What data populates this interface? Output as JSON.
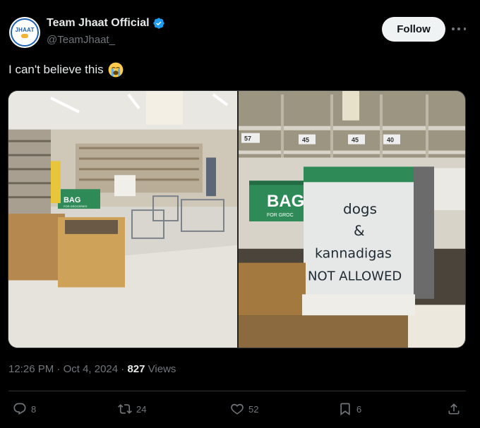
{
  "author": {
    "display_name": "Team Jhaat Official",
    "handle": "@TeamJhaat_",
    "avatar_text": "JHAAT",
    "verified": true
  },
  "header": {
    "follow_label": "Follow"
  },
  "tweet": {
    "text": "I can't believe this",
    "emoji": "loudly-crying-face"
  },
  "media": {
    "left_sign": {
      "bag_label": "BAG",
      "bag_sub": "FOR GROCERIES"
    },
    "right_sign": {
      "bag_label": "BAG",
      "bag_sub": "FOR GROC",
      "line1": "dogs",
      "line2": "&",
      "line3": "kannadigas",
      "line4": "NOT ALLOWED"
    },
    "price_tags": [
      "57",
      "45",
      "45",
      "40"
    ]
  },
  "meta": {
    "time": "12:26 PM",
    "separator": " · ",
    "date": "Oct 4, 2024",
    "views_count": "827",
    "views_label": " Views"
  },
  "actions": {
    "replies": "8",
    "reposts": "24",
    "likes": "52",
    "bookmarks": "6"
  },
  "colors": {
    "background": "#000000",
    "text_primary": "#e7e9ea",
    "text_secondary": "#71767b",
    "verified": "#1d9bf0",
    "sign_green": "#2e8b57"
  }
}
